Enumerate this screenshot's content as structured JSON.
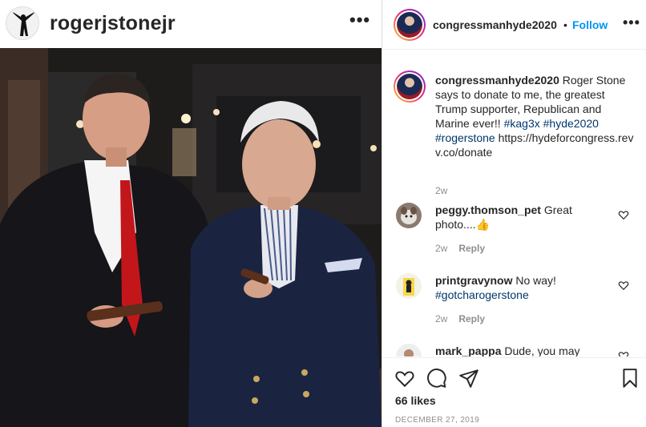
{
  "left_header": {
    "username": "rogerjstonejr",
    "more_label": "•••"
  },
  "photo": {
    "description_icon": "photo-two-men-with-cigars"
  },
  "post_header": {
    "username": "congressmanhyde2020",
    "separator": "•",
    "follow_label": "Follow",
    "more_label": "•••"
  },
  "caption": {
    "username": "congressmanhyde2020",
    "text": " Roger Stone says to donate to me, the greatest Trump supporter, Republican and Marine ever!! ",
    "tags": [
      "#kag3x",
      "#hyde2020",
      "#rogerstone"
    ],
    "link": "https://hydeforcongress.revv.co/donate",
    "time": "2w"
  },
  "comments": [
    {
      "username": "peggy.thomson_pet",
      "text": " Great photo....👍",
      "time": "2w",
      "reply_label": "Reply"
    },
    {
      "username": "printgravynow",
      "text": " No way! ",
      "tag": "#gotcharogerstone",
      "time": "2w",
      "reply_label": "Reply"
    },
    {
      "username": "mark_pappa",
      "text": " Dude, you may"
    }
  ],
  "actions": {
    "likes": "66 likes",
    "date": "DECEMBER 27, 2019"
  },
  "colors": {
    "link_blue": "#0095f6",
    "hashtag": "#00376b",
    "meta_gray": "#8e8e8e"
  }
}
